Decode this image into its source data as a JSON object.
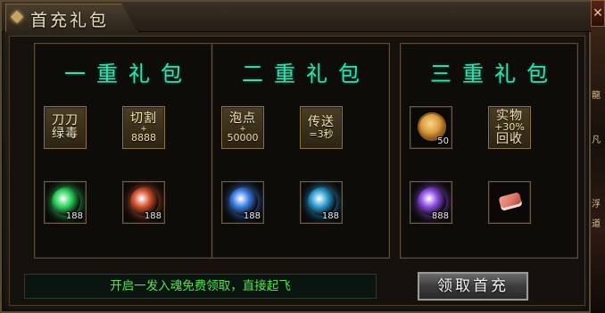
{
  "window": {
    "title": "首充礼包",
    "close_glyph": "✕"
  },
  "side_strip": {
    "texts": [
      "龍",
      "凡",
      "浮",
      "道"
    ]
  },
  "tiers": [
    {
      "title": "一重礼包",
      "slots_top": [
        {
          "type": "text",
          "lines": [
            "刀刀",
            "绿毒"
          ]
        },
        {
          "type": "text",
          "lines": [
            "切割",
            "+",
            "8888"
          ]
        }
      ],
      "slots_bottom": [
        {
          "type": "item",
          "icon": "green-orb-icon",
          "count": "188",
          "color": "#2ad05a"
        },
        {
          "type": "item",
          "icon": "red-helmet-icon",
          "count": "188",
          "color": "#d0502a"
        }
      ]
    },
    {
      "title": "二重礼包",
      "slots_top": [
        {
          "type": "text",
          "lines": [
            "泡点",
            "+",
            "50000"
          ]
        },
        {
          "type": "text",
          "lines": [
            "传送",
            "=3秒"
          ]
        }
      ],
      "slots_bottom": [
        {
          "type": "item",
          "icon": "blue-swirl-icon",
          "count": "188",
          "color": "#3a7ae0"
        },
        {
          "type": "item",
          "icon": "blue-green-gem-icon",
          "count": "188",
          "color": "#2a9ad0"
        }
      ]
    },
    {
      "title": "三重礼包",
      "slots_top": [
        {
          "type": "item",
          "icon": "gold-coin-icon",
          "count": "50",
          "color": "#d89a3a"
        },
        {
          "type": "text",
          "lines": [
            "实物",
            "+30%",
            "回收"
          ]
        }
      ],
      "slots_bottom": [
        {
          "type": "item",
          "icon": "purple-crystal-icon",
          "count": "888",
          "color": "#8a4ae0"
        },
        {
          "type": "item",
          "icon": "meat-icon",
          "count": "",
          "color": "#e07a6a"
        }
      ]
    }
  ],
  "notice": {
    "text": "开启一发入魂免费领取，直接起飞"
  },
  "claim_button": {
    "label": "领取首充"
  }
}
